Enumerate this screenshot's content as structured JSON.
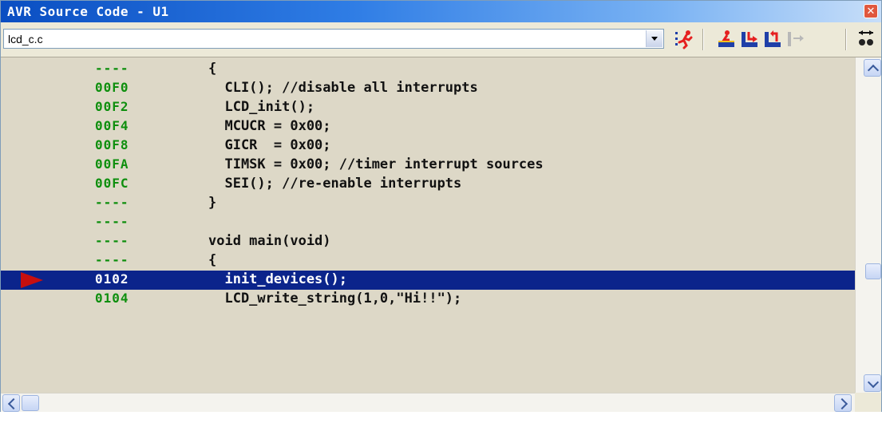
{
  "window": {
    "title": "AVR Source Code - U1"
  },
  "toolbar": {
    "file_select_value": "lcd_c.c",
    "buttons": [
      "run-to-cursor-icon",
      "step-over-icon",
      "step-into-icon",
      "step-out-icon",
      "go-to-next-icon",
      "breakpoint-icon"
    ]
  },
  "lines": [
    {
      "addr": "----",
      "code": "{"
    },
    {
      "addr": "00F0",
      "code": "  CLI(); //disable all interrupts"
    },
    {
      "addr": "00F2",
      "code": "  LCD_init();"
    },
    {
      "addr": "00F4",
      "code": "  MCUCR = 0x00;"
    },
    {
      "addr": "00F8",
      "code": "  GICR  = 0x00;"
    },
    {
      "addr": "00FA",
      "code": "  TIMSK = 0x00; //timer interrupt sources"
    },
    {
      "addr": "00FC",
      "code": "  SEI(); //re-enable interrupts"
    },
    {
      "addr": "----",
      "code": "}"
    },
    {
      "addr": "----",
      "code": ""
    },
    {
      "addr": "----",
      "code": "void main(void)"
    },
    {
      "addr": "----",
      "code": "{"
    },
    {
      "addr": "0102",
      "code": "  init_devices();",
      "current": true
    },
    {
      "addr": "0104",
      "code": "  LCD_write_string(1,0,\"Hi!!\");"
    }
  ]
}
